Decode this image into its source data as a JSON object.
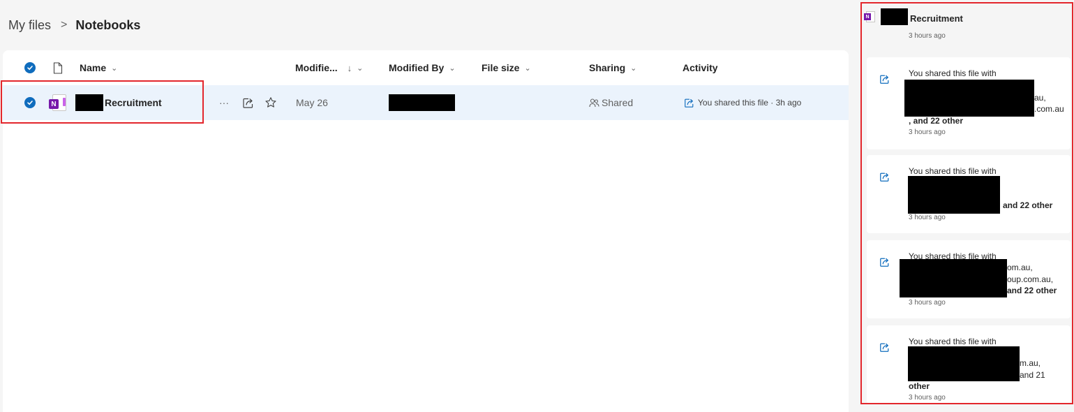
{
  "breadcrumb": {
    "root": "My files",
    "separator": ">",
    "current": "Notebooks"
  },
  "columns": {
    "name": "Name",
    "modified": "Modifie...",
    "modified_sort": "↓",
    "modified_by": "Modified By",
    "file_size": "File size",
    "sharing": "Sharing",
    "activity": "Activity",
    "chevron": "⌄"
  },
  "file": {
    "icon_letter": "N",
    "name": "Recruitment",
    "more": "···",
    "modified": "May 26",
    "sharing": "Shared",
    "activity": "You shared this file · 3h ago"
  },
  "details": {
    "icon_letter": "N",
    "title": "Recruitment",
    "time": "3 hours ago",
    "cards": [
      {
        "lead": "You shared this file with",
        "lines": [
          "au,",
          ".com.au",
          ", and 22 other"
        ],
        "time": "3 hours ago"
      },
      {
        "lead": "You shared this file with",
        "lines": [
          "and 22 other"
        ],
        "time": "3 hours ago"
      },
      {
        "lead": "You shared this file with",
        "lines": [
          "om.au,",
          "oup.com.au,",
          "and 22 other"
        ],
        "time": "3 hours ago"
      },
      {
        "lead": "You shared this file with",
        "lines": [
          "m.au,",
          "and 21",
          "other"
        ],
        "time": "3 hours ago"
      }
    ]
  },
  "colors": {
    "accent": "#0f6cbd",
    "highlight": "#e3262c",
    "onenote": "#7719aa",
    "selected_row": "#ebf3fc"
  }
}
